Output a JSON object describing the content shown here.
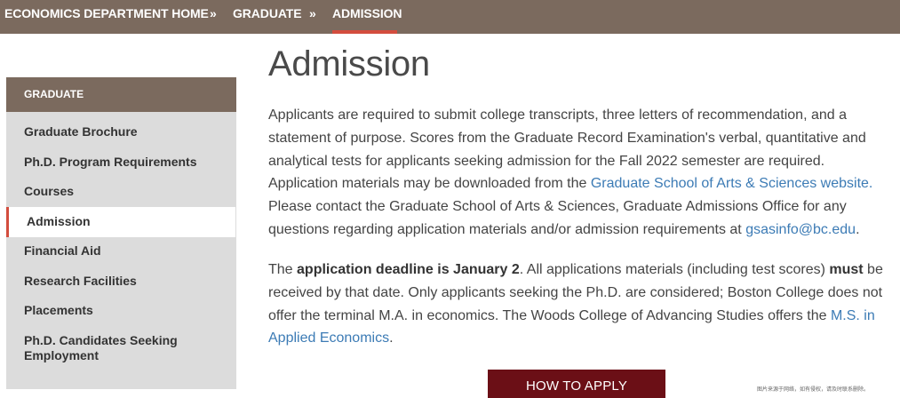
{
  "breadcrumb": {
    "items": [
      "ECONOMICS DEPARTMENT HOME",
      "GRADUATE",
      "ADMISSION"
    ],
    "separator": "»",
    "active_color": "#d34d3e"
  },
  "sidebar": {
    "header": "GRADUATE",
    "items": [
      {
        "label": "Graduate Brochure"
      },
      {
        "label": "Ph.D. Program Requirements"
      },
      {
        "label": "Courses"
      },
      {
        "label": "Admission",
        "active": true
      },
      {
        "label": "Financial Aid"
      },
      {
        "label": "Research Facilities"
      },
      {
        "label": "Placements"
      },
      {
        "label": "Ph.D. Candidates Seeking Employment"
      }
    ]
  },
  "main": {
    "title": "Admission",
    "p1": {
      "text_a": "Applicants are required to submit college transcripts, three letters of recommendation, and a statement of purpose. Scores from the Graduate Record Examination's verbal, quantitative and analytical tests for applicants seeking admission for the Fall 2022 semester are required. Application materials may be downloaded from the ",
      "link1": "Graduate School of Arts & Sciences website.",
      "text_b": " Please contact the Graduate School of Arts & Sciences, Graduate Admissions Office for any questions regarding application materials and/or admission requirements at ",
      "link2": "gsasinfo@bc.edu",
      "text_c": "."
    },
    "p2": {
      "text_a": "The ",
      "bold1": "application deadline is January 2",
      "text_b": ". All applications materials (including test scores) ",
      "bold2": "must",
      "text_c": " be received by that date. Only applicants seeking the Ph.D. are considered; Boston College does not offer the terminal M.A. in economics. The Woods College of Advancing Studies offers the ",
      "link": "M.S. in Applied Economics",
      "text_d": "."
    },
    "button": "HOW TO APPLY"
  },
  "watermark": "图片来源于网络，如有侵权，请及时联系删除。",
  "colors": {
    "brand_brown": "#7b6a5e",
    "accent_red": "#d34d3e",
    "button_maroon": "#6b0f16",
    "link_blue": "#3c7bb5"
  }
}
